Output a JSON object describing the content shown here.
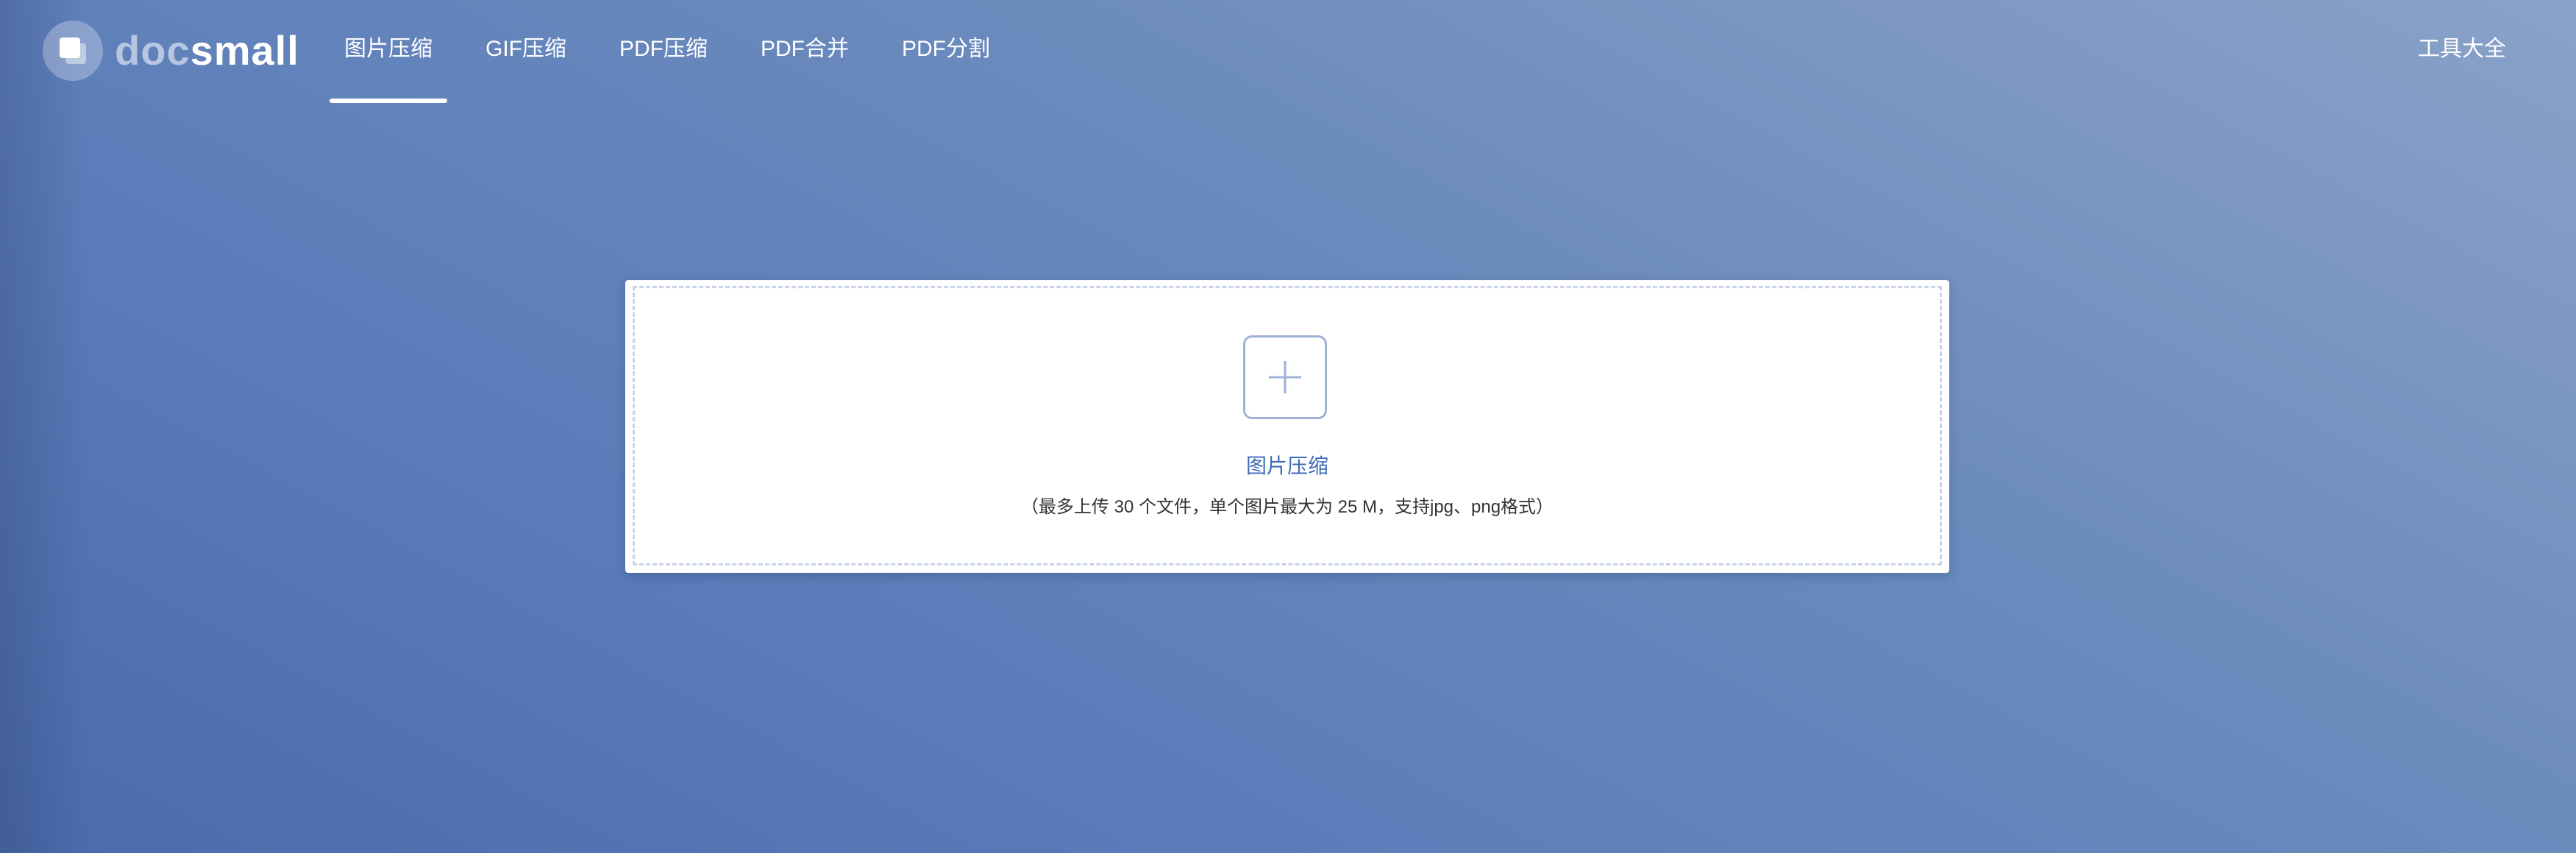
{
  "brand": {
    "logo_icon": "stacked-squares-logo",
    "name_part1": "doc",
    "name_part2": "small"
  },
  "nav": {
    "items": [
      {
        "label": "图片压缩",
        "active": true
      },
      {
        "label": "GIF压缩",
        "active": false
      },
      {
        "label": "PDF压缩",
        "active": false
      },
      {
        "label": "PDF合并",
        "active": false
      },
      {
        "label": "PDF分割",
        "active": false
      }
    ],
    "tools_label": "工具大全"
  },
  "upload": {
    "plus_icon": "plus-icon",
    "title": "图片压缩",
    "hint": "（最多上传 30 个文件，单个图片最大为 25 M，支持jpg、png格式）"
  },
  "colors": {
    "accent": "#3c6bb5",
    "background_start": "#4a6aa9",
    "background_end": "#8aa2c8",
    "dropzone_border": "#c8d3e4"
  }
}
